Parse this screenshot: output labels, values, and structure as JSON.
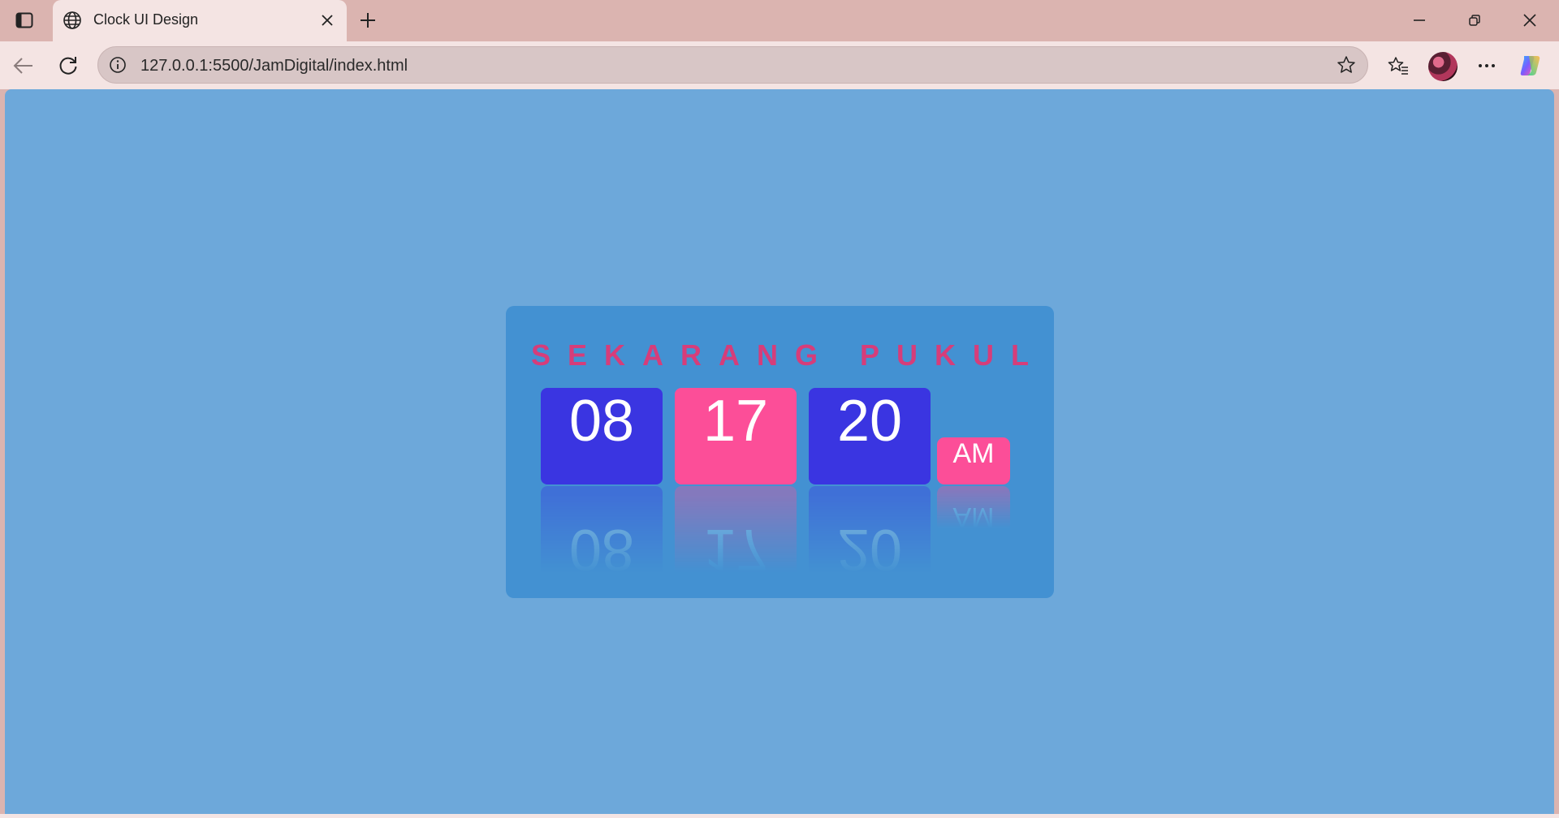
{
  "browser": {
    "tab_title": "Clock UI Design",
    "address": "127.0.0.1:5500/JamDigital/index.html"
  },
  "clock": {
    "heading": "SEKARANG PUKUL",
    "hours": "08",
    "minutes": "17",
    "seconds": "20",
    "period": "AM"
  },
  "colors": {
    "page_bg": "#6da8da",
    "card_bg": "#4391d2",
    "heading": "#d63d7a",
    "blue_box": "#3a35e1",
    "pink_box": "#fc4e98"
  },
  "icons": {
    "tab_actions": "tab-actions-icon",
    "favicon": "globe-icon",
    "tab_close": "close-icon",
    "new_tab": "plus-icon",
    "minimize": "minimize-icon",
    "restore": "restore-icon",
    "close_window": "close-icon",
    "back": "back-arrow-icon",
    "refresh": "refresh-icon",
    "site_info": "info-icon",
    "favorite": "star-icon",
    "favorites": "favorites-icon",
    "more": "more-icon",
    "copilot": "copilot-icon"
  }
}
